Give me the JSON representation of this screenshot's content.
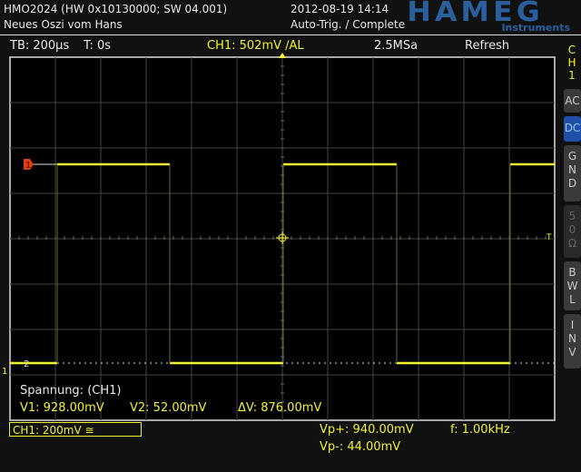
{
  "header": {
    "device": "HMO2024 (HW 0x10130000; SW 04.001)",
    "name": "Neues Oszi vom Hans",
    "datetime": "2012-08-19 14:14",
    "trigger_status": "Auto-Trig. / Complete",
    "logo": "HAMEG Instruments"
  },
  "status": {
    "timebase": "TB: 200µs",
    "time": "T: 0s",
    "trigger": "CH1: 502mV ∕AL",
    "sample_rate": "2.5MSa",
    "mode": "Refresh"
  },
  "side": {
    "channel": "CH1",
    "buttons": [
      {
        "label": "AC",
        "active": false
      },
      {
        "label": "DC",
        "active": true
      },
      {
        "label": "GND",
        "active": false
      },
      {
        "label": "50Ω",
        "active": false,
        "disabled": true
      },
      {
        "label": "BWL",
        "active": false
      },
      {
        "label": "INV",
        "active": false
      }
    ]
  },
  "markers": {
    "ch1": "1",
    "ref2": "2",
    "trigger": "T",
    "ground": "1"
  },
  "measure": {
    "title": "Spannung: (CH1)",
    "v1": "V1: 928.00mV",
    "v2": "V2: 52.00mV",
    "dv": "ΔV: 876.00mV"
  },
  "footer": {
    "ch1_scale": "CH1: 200mV ≅",
    "vpp": "Vp+: 940.00mV",
    "vpm": "Vp-: 44.00mV",
    "freq": "f: 1.00kHz"
  },
  "colors": {
    "trace": "#f2f230",
    "active_button": "#1f4fa8",
    "marker": "#e04010"
  }
}
